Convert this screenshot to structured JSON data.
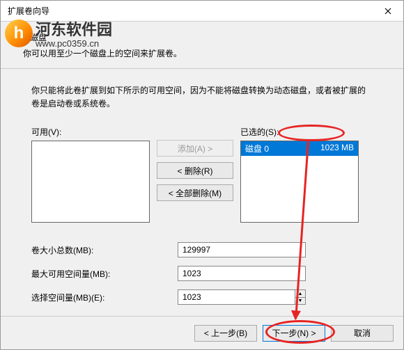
{
  "titlebar": {
    "title": "扩展卷向导"
  },
  "watermark": {
    "name": "河东软件园",
    "url": "www.pc0359.cn",
    "icon_letter": "h"
  },
  "header": {
    "title": "选择磁盘",
    "subtitle": "你可以用至少一个磁盘上的空间来扩展卷。"
  },
  "body": {
    "intro": "你只能将此卷扩展到如下所示的可用空间，因为不能将磁盘转换为动态磁盘，或者被扩展的卷是启动卷或系统卷。",
    "available_label": "可用(V):",
    "selected_label": "已选的(S):",
    "buttons": {
      "add": "添加(A) >",
      "remove": "< 删除(R)",
      "remove_all": "< 全部删除(M)"
    },
    "selected_items": [
      {
        "name": "磁盘 0",
        "size": "1023 MB"
      }
    ],
    "rows": {
      "total_label": "卷大小总数(MB):",
      "total_value": "129997",
      "max_label": "最大可用空间量(MB):",
      "max_value": "1023",
      "sel_label": "选择空间量(MB)(E):",
      "sel_value": "1023"
    }
  },
  "footer": {
    "back": "< 上一步(B)",
    "next": "下一步(N) >",
    "cancel": "取消"
  }
}
